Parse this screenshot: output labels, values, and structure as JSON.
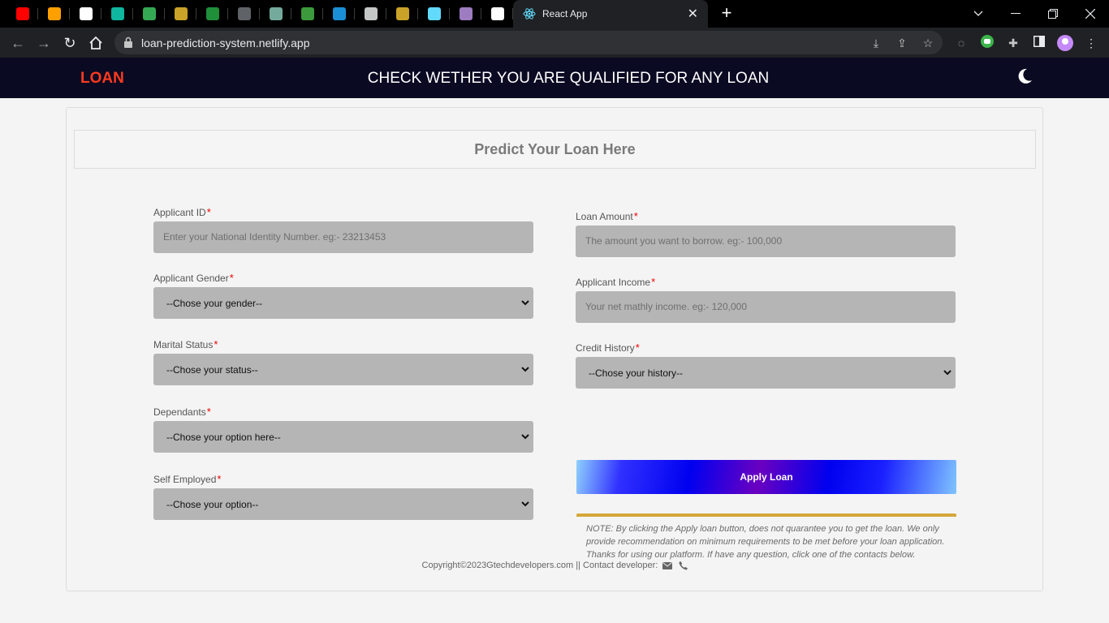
{
  "browser": {
    "active_tab_title": "React App",
    "url": "loan-prediction-system.netlify.app",
    "pinned_tabs": [
      {
        "icon": "youtube-icon",
        "color": "#ff0000"
      },
      {
        "icon": "firebase-icon",
        "color": "#ffa000"
      },
      {
        "icon": "github-icon",
        "color": "#ffffff"
      },
      {
        "icon": "diamond-icon",
        "color": "#0fb6a0"
      },
      {
        "icon": "google-drive-icon",
        "color": "#34a853"
      },
      {
        "icon": "crest-icon",
        "color": "#c9a227"
      },
      {
        "icon": "w-app-icon",
        "color": "#1f8f3a"
      },
      {
        "icon": "laptop-icon",
        "color": "#5f6368"
      },
      {
        "icon": "chatgpt-icon",
        "color": "#74aa9c"
      },
      {
        "icon": "green-app-icon",
        "color": "#3c9a3c"
      },
      {
        "icon": "k-icon",
        "color": "#1a8fd6"
      },
      {
        "icon": "globe-icon",
        "color": "#c4c7c5"
      },
      {
        "icon": "emblem-icon",
        "color": "#c9a227"
      },
      {
        "icon": "react-icon",
        "color": "#61dafb"
      },
      {
        "icon": "heroku-icon",
        "color": "#9e7cc1"
      },
      {
        "icon": "download-icon",
        "color": "#ffffff"
      }
    ]
  },
  "navbar": {
    "brand": "LOAN",
    "title": "CHECK WETHER YOU ARE QUALIFIED FOR ANY LOAN",
    "theme_icon": "moon-icon"
  },
  "form": {
    "heading": "Predict Your Loan Here",
    "required_mark": "*",
    "left": [
      {
        "label": "Applicant ID",
        "type": "input",
        "placeholder": "Enter your National Identity Number. eg:- 23213453"
      },
      {
        "label": "Applicant Gender",
        "type": "select",
        "value": "--Chose your gender--"
      },
      {
        "label": "Marital Status",
        "type": "select",
        "value": "--Chose your status--"
      },
      {
        "label": "Dependants",
        "type": "select",
        "value": "--Chose your option here--"
      },
      {
        "label": "Self Employed",
        "type": "select",
        "value": "--Chose your option--"
      }
    ],
    "right": [
      {
        "label": "Loan Amount",
        "type": "input",
        "placeholder": "The amount you want to borrow. eg:- 100,000"
      },
      {
        "label": "Applicant Income",
        "type": "input",
        "placeholder": "Your net mathly income. eg:- 120,000"
      },
      {
        "label": "Credit History",
        "type": "select",
        "value": "--Chose your history--"
      }
    ],
    "apply_label": "Apply Loan",
    "note": "NOTE: By clicking the Apply loan button, does not quarantee you to get the loan. We only provide recommendation on minimum requirements to be met before your loan application. Thanks for using our platform. If have any question, click one of the contacts below."
  },
  "footer": {
    "text": "Copyright©2023Gtechdevelopers.com || Contact developer:",
    "icons": [
      "envelope-icon",
      "phone-icon"
    ]
  }
}
